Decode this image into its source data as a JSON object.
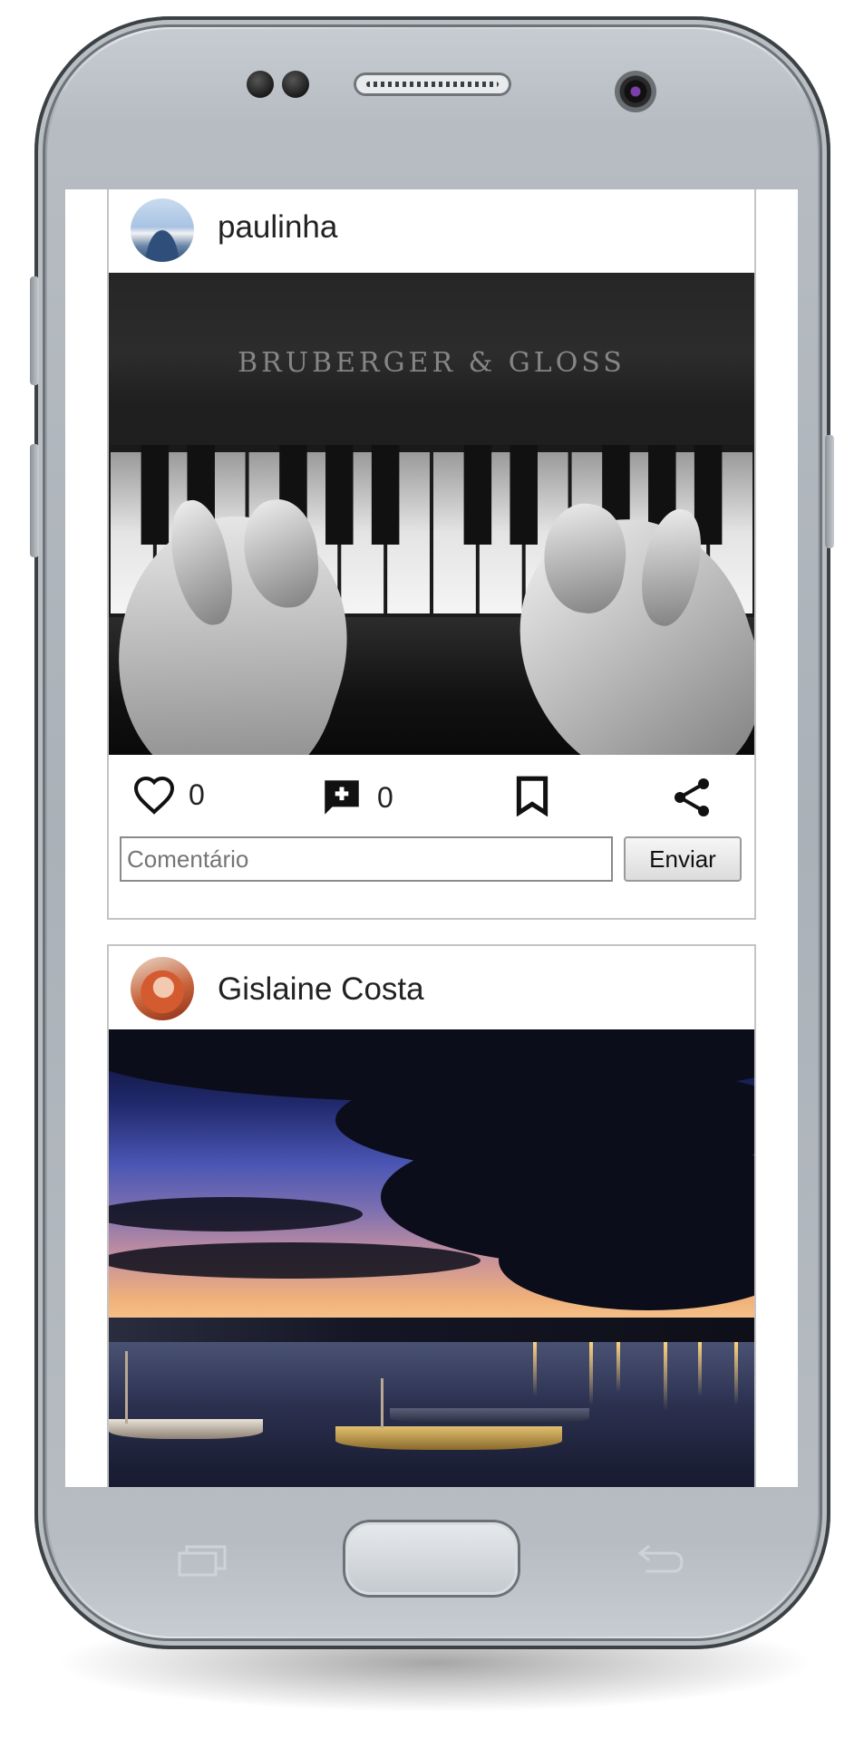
{
  "posts": [
    {
      "username": "paulinha",
      "photo_text": "BRUBERGER & GLOSS",
      "likes": "0",
      "comments": "0",
      "comment_placeholder": "Comentário",
      "send_label": "Enviar"
    },
    {
      "username": "Gislaine Costa"
    }
  ],
  "icons": {
    "like": "heart-outline-icon",
    "comment": "add-comment-icon",
    "save": "bookmark-outline-icon",
    "share": "share-icon"
  }
}
